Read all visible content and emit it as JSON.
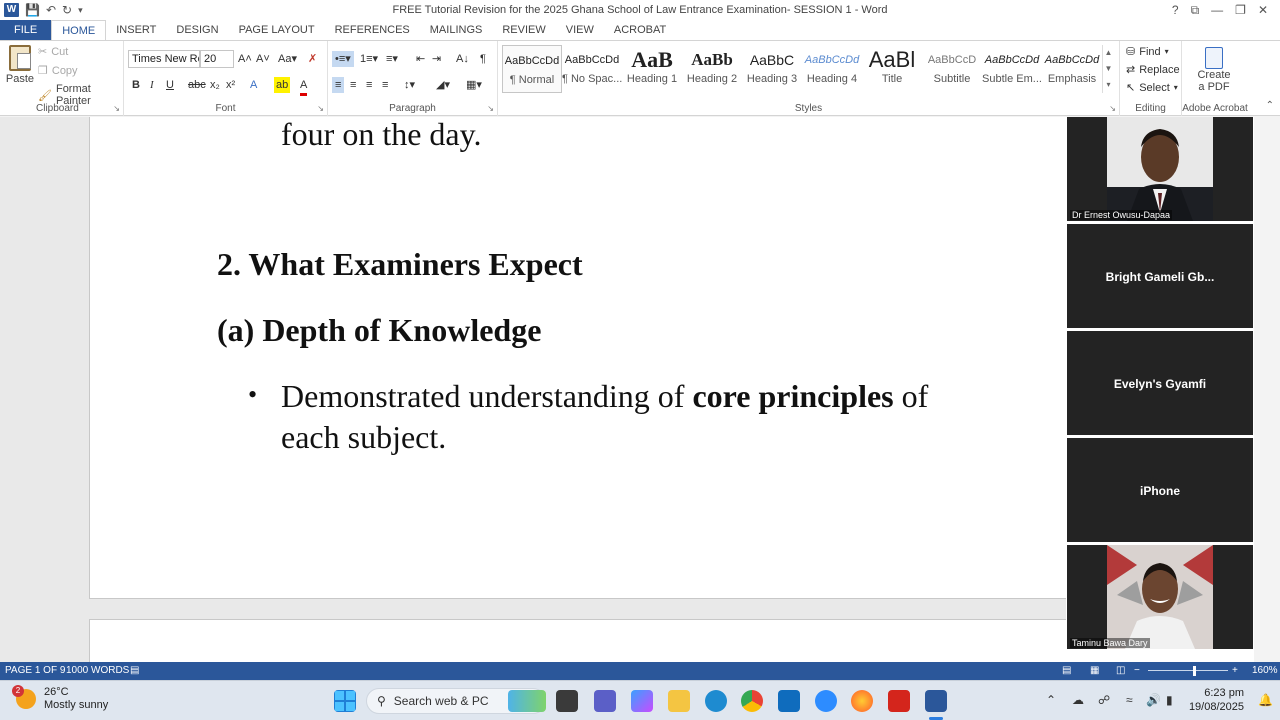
{
  "window": {
    "title": "FREE Tutorial Revision for the 2025 Ghana School of Law Entrance Examination- SESSION 1 - Word",
    "app_logo_letter": "W",
    "controls": [
      "?",
      "⧉",
      "—",
      "❐",
      "✕"
    ]
  },
  "tabs": [
    "FILE",
    "HOME",
    "INSERT",
    "DESIGN",
    "PAGE LAYOUT",
    "REFERENCES",
    "MAILINGS",
    "REVIEW",
    "VIEW",
    "ACROBAT"
  ],
  "active_tab": "HOME",
  "ribbon": {
    "clipboard": {
      "label": "Clipboard",
      "paste": "Paste",
      "cut": "Cut",
      "copy": "Copy",
      "format_painter": "Format Painter"
    },
    "font": {
      "label": "Font",
      "family": "Times New Ro",
      "size": "20"
    },
    "paragraph": {
      "label": "Paragraph"
    },
    "styles": {
      "label": "Styles",
      "items": [
        {
          "preview": "AaBbCcDd",
          "name": "¶ Normal"
        },
        {
          "preview": "AaBbCcDd",
          "name": "¶ No Spac..."
        },
        {
          "preview": "AaB",
          "name": "Heading 1"
        },
        {
          "preview": "AaBb",
          "name": "Heading 2"
        },
        {
          "preview": "AaBbC",
          "name": "Heading 3"
        },
        {
          "preview": "AaBbCcDd",
          "name": "Heading 4"
        },
        {
          "preview": "AaBl",
          "name": "Title"
        },
        {
          "preview": "AaBbCcD",
          "name": "Subtitle"
        },
        {
          "preview": "AaBbCcDd",
          "name": "Subtle Em..."
        },
        {
          "preview": "AaBbCcDd",
          "name": "Emphasis"
        }
      ]
    },
    "editing": {
      "label": "Editing",
      "find": "Find",
      "replace": "Replace",
      "select": "Select"
    },
    "acrobat": {
      "label": "Adobe Acrobat",
      "create_pdf_line1": "Create",
      "create_pdf_line2": "a PDF"
    }
  },
  "document": {
    "line_top": "four on the day.",
    "heading": "2. What Examiners Expect",
    "subheading": "(a) Depth of Knowledge",
    "bullet_symbol": "•",
    "bullet_part1": "Demonstrated understanding of ",
    "bullet_bold": "core principles",
    "bullet_part2": " of",
    "bullet_line2": "each subject."
  },
  "participants": [
    {
      "name": "Dr Ernest Owusu-Dapaa",
      "video": true
    },
    {
      "name": "Bright Gameli Gb...",
      "video": false
    },
    {
      "name": "Evelyn's Gyamfi",
      "video": false
    },
    {
      "name": "iPhone",
      "video": false
    },
    {
      "name": "Taminu Bawa Dary",
      "video": true
    }
  ],
  "statusbar": {
    "page": "PAGE 1 OF 9",
    "words": "1000 WORDS",
    "zoom": "160%"
  },
  "taskbar": {
    "weather_temp": "26°C",
    "weather_desc": "Mostly sunny",
    "weather_badge": "2",
    "search_placeholder": "Search web & PC",
    "time": "6:23 pm",
    "date": "19/08/2025"
  },
  "colors": {
    "word_blue": "#2b579a",
    "tile_bg": "#232323"
  }
}
